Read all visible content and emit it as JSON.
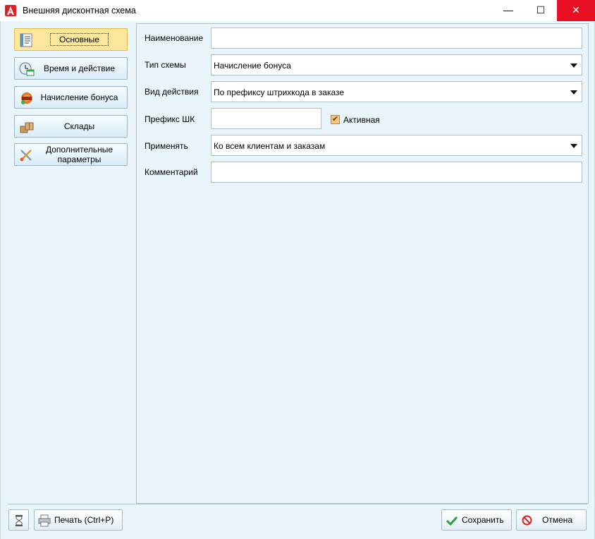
{
  "window": {
    "title": "Внешняя дисконтная схема",
    "min_glyph": "—",
    "max_glyph": "☐",
    "close_glyph": "✕"
  },
  "nav": {
    "items": [
      {
        "label": "Основные",
        "icon": "document-lines-icon",
        "active": true
      },
      {
        "label": "Время и действие",
        "icon": "clock-calendar-icon",
        "active": false
      },
      {
        "label": "Начисление бонуса",
        "icon": "bonus-badge-icon",
        "active": false
      },
      {
        "label": "Склады",
        "icon": "boxes-icon",
        "active": false
      },
      {
        "label": "Дополнительные параметры",
        "icon": "tools-icon",
        "active": false
      }
    ]
  },
  "form": {
    "name_label": "Наименование",
    "name_value": "",
    "scheme_type_label": "Тип схемы",
    "scheme_type_value": "Начисление бонуса",
    "action_type_label": "Вид действия",
    "action_type_value": "По префиксу штрихкода в заказе",
    "prefix_label": "Префикс ШК",
    "prefix_value": "",
    "active_label": "Активная",
    "active_checked": true,
    "apply_label": "Применять",
    "apply_value": "Ко всем клиентам и заказам",
    "comment_label": "Комментарий",
    "comment_value": ""
  },
  "footer": {
    "print_label": "Печать (Ctrl+P)",
    "save_label": "Сохранить",
    "cancel_label": "Отмена"
  },
  "colors": {
    "background": "#e9f4fb",
    "active_nav": "#fce79c",
    "close_button": "#e81123",
    "checkbox": "#f6c77d"
  }
}
